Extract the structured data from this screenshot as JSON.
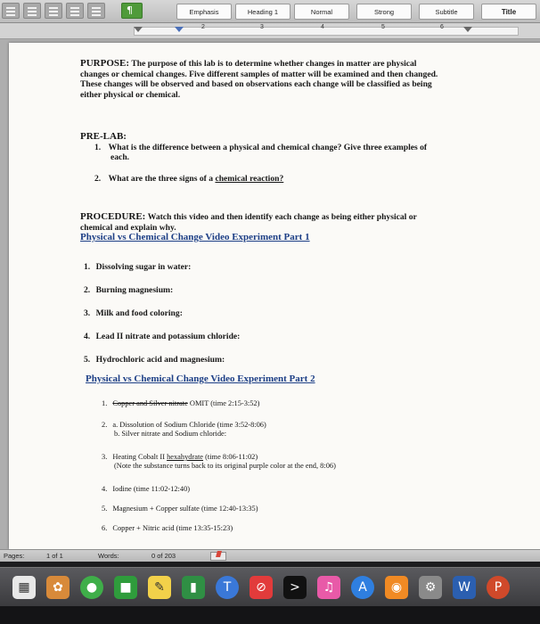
{
  "ribbon": {
    "styles": [
      "Emphasis",
      "Heading 1",
      "Normal",
      "Strong",
      "Subtitle",
      "Title"
    ]
  },
  "ruler": {
    "numbers": [
      "2",
      "3",
      "4",
      "5",
      "6"
    ]
  },
  "document": {
    "purpose": {
      "heading": "PURPOSE:",
      "lines": [
        "The purpose of this lab is to determine whether changes in matter are physical",
        "changes or chemical changes. Five different samples of matter will be examined and then changed.",
        "These changes will be observed and based on observations each change will be classified as being",
        "either physical or chemical."
      ]
    },
    "prelab": {
      "heading": "PRE-LAB:",
      "q1_num": "1.",
      "q1_line1": "What is the difference between a physical and chemical change? Give three examples of",
      "q1_line2": "each.",
      "q2_num": "2.",
      "q2_text": "What are the three signs of a",
      "q2_link": "chemical reaction?"
    },
    "procedure": {
      "heading": "PROCEDURE:",
      "line1": "Watch this video and then identify each change as being either physical or",
      "line2": "chemical and explain why.",
      "part1_link": "Physical vs Chemical Change Video Experiment Part 1",
      "part1_items": [
        {
          "num": "1.",
          "text": "Dissolving sugar in water:"
        },
        {
          "num": "2.",
          "text": "Burning magnesium:"
        },
        {
          "num": "3.",
          "text": "Milk and food coloring:"
        },
        {
          "num": "4.",
          "text": "Lead II nitrate and potassium chloride:"
        },
        {
          "num": "5.",
          "text": "Hydrochloric acid and magnesium:"
        }
      ],
      "part2_link": "Physical vs Chemical Change Video Experiment Part 2",
      "p2_1_num": "1.",
      "p2_1_struck": "Copper and Silver nitrate",
      "p2_1_rest": "OMIT (time 2:15-3:52)",
      "p2_2_num": "2.",
      "p2_2a": "a. Dissolution of Sodium Chloride  (time 3:52-8:06)",
      "p2_2b": "b. Silver nitrate and Sodium chloride:",
      "p2_3_num": "3.",
      "p2_3_pre": "Heating Cobalt II",
      "p2_3_link": "hexahydrate",
      "p2_3_post": "(time 8:06-11:02)",
      "p2_3_note": "(Note the substance turns back to its original purple color at the end, 8:06)",
      "p2_4_num": "4.",
      "p2_4": "Iodine (time 11:02-12:40)",
      "p2_5_num": "5.",
      "p2_5": "Magnesium + Copper sulfate (time 12:40-13:35)",
      "p2_6_num": "6.",
      "p2_6": "Copper + Nitric acid (time 13:35-15:23)"
    }
  },
  "status_bar": {
    "pages_label": "Pages:",
    "pages_value": "1 of 1",
    "words_label": "Words:",
    "words_value": "0 of 203"
  },
  "dock": {
    "apps": [
      {
        "icon": "calendar-icon",
        "color": "#e8e8e8",
        "glyph": "▦"
      },
      {
        "icon": "photos-icon",
        "color": "#d88a3a",
        "glyph": "✿"
      },
      {
        "icon": "messages-icon",
        "color": "#3fae49",
        "glyph": "●"
      },
      {
        "icon": "facetime-icon",
        "color": "#2f9c3c",
        "glyph": "■"
      },
      {
        "icon": "notes-icon",
        "color": "#f2d14a",
        "glyph": "✎"
      },
      {
        "icon": "numbers-icon",
        "color": "#2f8f44",
        "glyph": "▮"
      },
      {
        "icon": "keynote-icon",
        "color": "#3a78d8",
        "glyph": "T"
      },
      {
        "icon": "news-icon",
        "color": "#e23b3b",
        "glyph": "⊘"
      },
      {
        "icon": "terminal-icon",
        "color": "#111111",
        "glyph": ">"
      },
      {
        "icon": "music-icon",
        "color": "#e85aa8",
        "glyph": "♫"
      },
      {
        "icon": "app-store-icon",
        "color": "#2f7fe0",
        "glyph": "A"
      },
      {
        "icon": "ibooks-icon",
        "color": "#f08a24",
        "glyph": "◉"
      },
      {
        "icon": "system-preferences-icon",
        "color": "#8a8a8a",
        "glyph": "⚙"
      },
      {
        "icon": "word-icon",
        "color": "#2b5fb0",
        "glyph": "W"
      },
      {
        "icon": "powerpoint-icon",
        "color": "#d0492a",
        "glyph": "P"
      }
    ]
  }
}
